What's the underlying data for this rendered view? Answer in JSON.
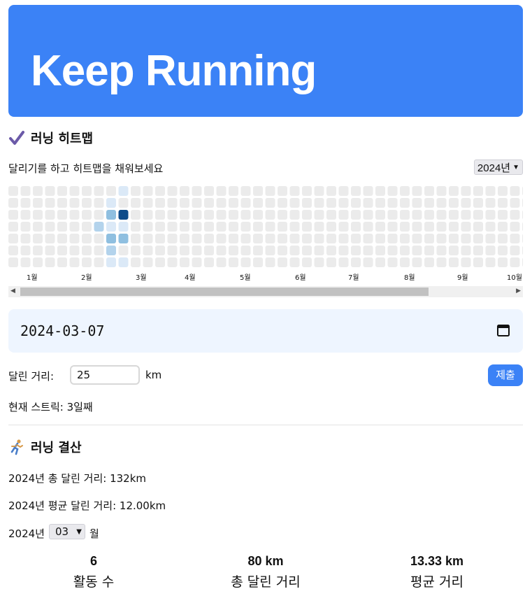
{
  "header": {
    "title": "Keep Running"
  },
  "heatmap_section": {
    "title": "러닝 히트맵",
    "subtitle": "달리기를 하고 히트맵을 채워보세요",
    "year_selected": "2024년",
    "months": [
      "1월",
      "2월",
      "3월",
      "4월",
      "5월",
      "6월",
      "7월",
      "8월",
      "9월",
      "10월"
    ],
    "active_days": [
      {
        "week": 8,
        "day": 1,
        "level": 1
      },
      {
        "week": 8,
        "day": 2,
        "level": 3
      },
      {
        "week": 8,
        "day": 3,
        "level": 1
      },
      {
        "week": 8,
        "day": 4,
        "level": 3
      },
      {
        "week": 8,
        "day": 5,
        "level": 2
      },
      {
        "week": 7,
        "day": 3,
        "level": 2
      },
      {
        "week": 9,
        "day": 0,
        "level": 1
      },
      {
        "week": 9,
        "day": 2,
        "level": 4
      },
      {
        "week": 9,
        "day": 3,
        "level": 1
      },
      {
        "week": 9,
        "day": 4,
        "level": 3
      },
      {
        "week": 8,
        "day": 6,
        "level": 1
      },
      {
        "week": 9,
        "day": 6,
        "level": 1
      }
    ],
    "colors": {
      "empty": "#ebebeb",
      "level1": "#dbe9f7",
      "level2": "#b3d3ec",
      "level3": "#8fbfe0",
      "level4": "#0f4c8a"
    }
  },
  "entry": {
    "date_value": "2024-03-07",
    "distance_label": "달린 거리:",
    "distance_value": "25",
    "unit": "km",
    "submit_label": "제출",
    "streak_text": "현재 스트릭: 3일째"
  },
  "summary": {
    "title": "러닝 결산",
    "year_total": "2024년 총 달린 거리: 132km",
    "year_avg": "2024년 평균 달린 거리: 12.00km",
    "year_label": "2024년",
    "month_selected": "03",
    "month_unit": "월",
    "stats": [
      {
        "value": "6",
        "label": "활동 수"
      },
      {
        "value": "80 km",
        "label": "총 달린 거리"
      },
      {
        "value": "13.33 km",
        "label": "평균 거리"
      }
    ]
  }
}
